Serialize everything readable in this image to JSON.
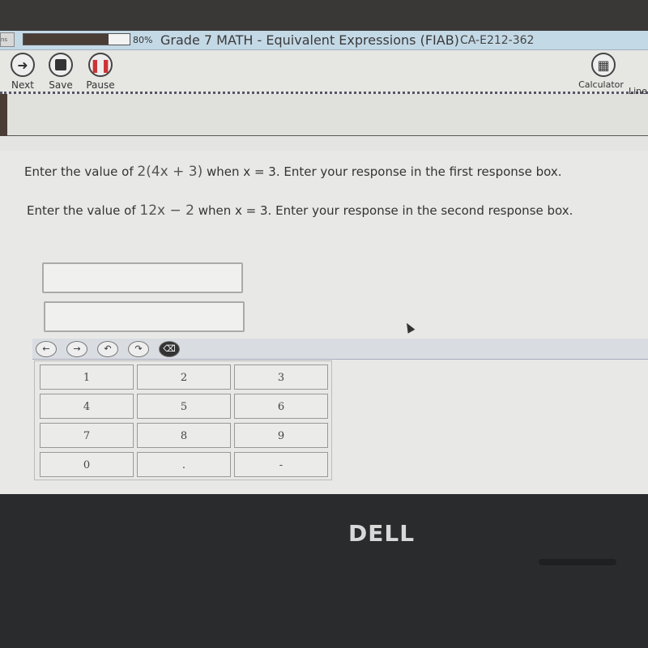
{
  "header": {
    "progress_percent": 80,
    "progress_label": "80%",
    "title": "Grade 7 MATH - Equivalent Expressions (FIAB)",
    "code": "CA-E212-362",
    "ctl_label": "ns"
  },
  "toolbar": {
    "next": "Next",
    "save": "Save",
    "pause": "Pause",
    "calculator": "Calculator",
    "line": "Line"
  },
  "question": {
    "q1_prefix": "Enter the value of",
    "q1_expr": "2(4x + 3)",
    "q1_suffix": "when x = 3. Enter your response in the first response box.",
    "q2_prefix": "Enter the value of",
    "q2_expr": "12x − 2",
    "q2_suffix": "when x = 3. Enter your response in the second response box."
  },
  "responses": {
    "box1_value": "",
    "box2_value": ""
  },
  "nav_buttons": [
    "←",
    "→",
    "↶",
    "↷",
    "⌫"
  ],
  "keypad": [
    "1",
    "2",
    "3",
    "4",
    "5",
    "6",
    "7",
    "8",
    "9",
    "0",
    ".",
    "-"
  ],
  "brand": "DELL"
}
